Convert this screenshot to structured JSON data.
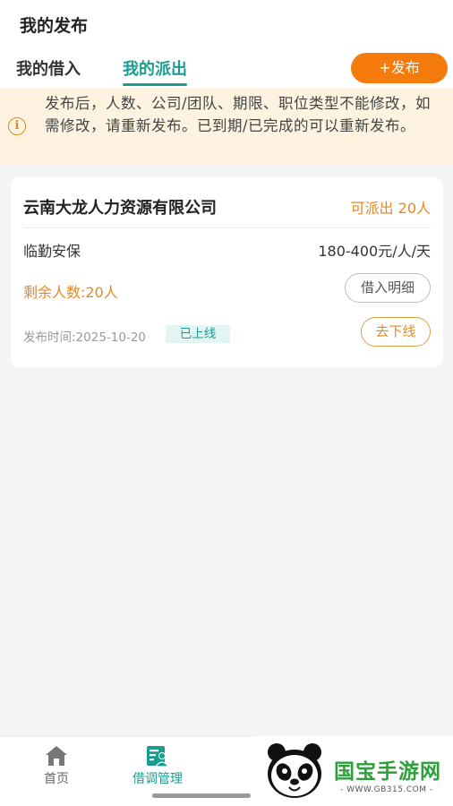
{
  "header": {
    "title": "我的发布"
  },
  "tabs": [
    {
      "label": "我的借入",
      "active": false
    },
    {
      "label": "我的派出",
      "active": true
    }
  ],
  "publish_button": {
    "label": "+发布"
  },
  "notice": {
    "icon": "info-icon",
    "text": "发布后，人数、公司/团队、期限、职位类型不能修改，如需修改，请重新发布。已到期/已完成的可以重新发布。"
  },
  "card": {
    "company": "云南大龙人力资源有限公司",
    "available": "可派出 20人",
    "job_type": "临勤安保",
    "salary": "180-400元/人/天",
    "remaining": "剩余人数:20人",
    "detail_button": "借入明细",
    "publish_time": "发布时间:2025-10-20",
    "status": "已上线",
    "offline_button": "去下线"
  },
  "bottom_nav": [
    {
      "label": "首页",
      "icon": "home-icon"
    },
    {
      "label": "借调管理",
      "icon": "loan-manage-icon",
      "active": true
    }
  ],
  "watermark": {
    "title": "国宝手游网",
    "url": "- WWW.GB315.COM -"
  },
  "colors": {
    "accent": "#1a9d8f",
    "orange": "#f57c0c",
    "notice_bg": "#fdf3e0"
  }
}
